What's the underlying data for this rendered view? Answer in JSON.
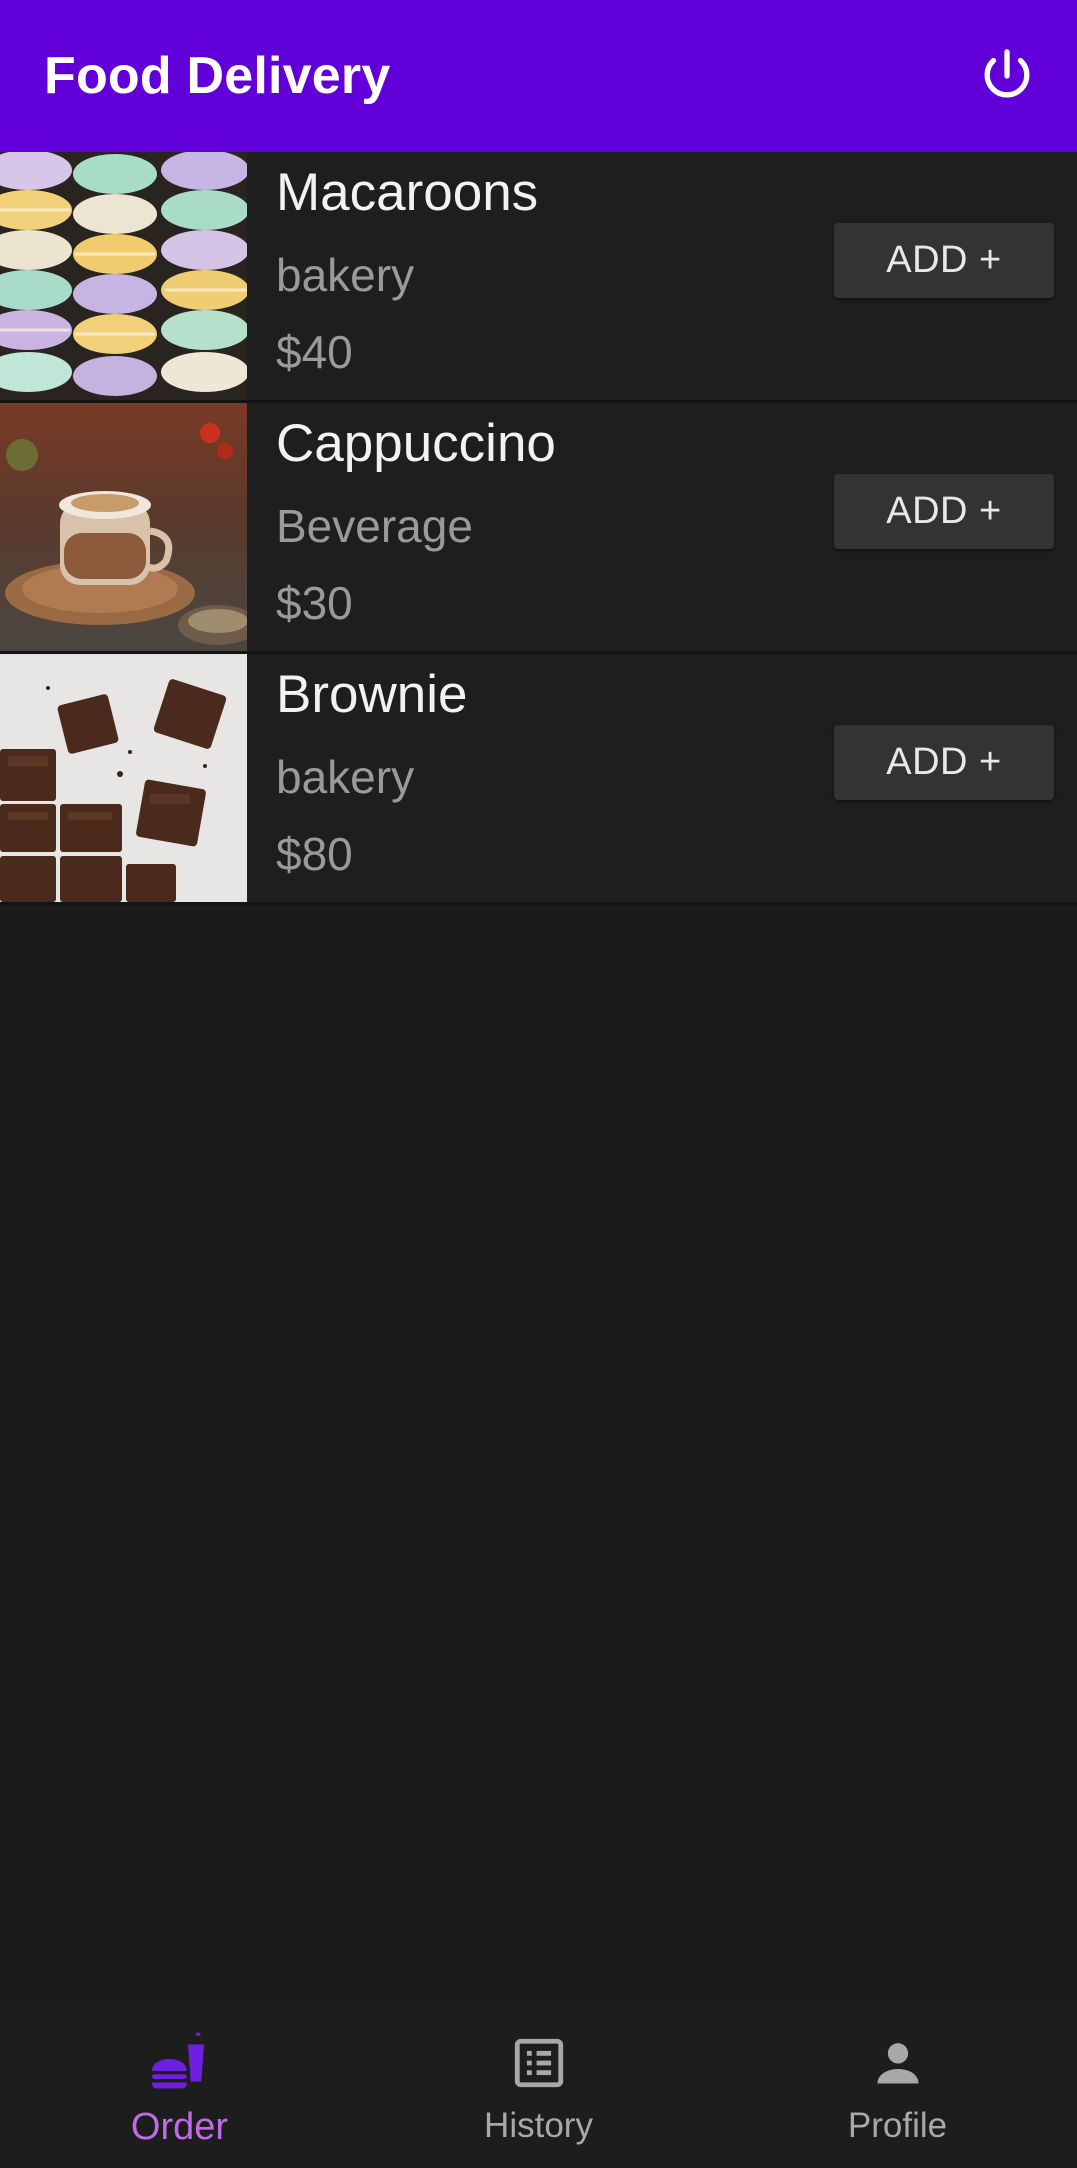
{
  "app_bar": {
    "title": "Food Delivery",
    "power_icon": "power-icon",
    "background": "#6200d9"
  },
  "items": [
    {
      "name": "Macaroons",
      "category": "bakery",
      "price": "$40",
      "add_label": "ADD +",
      "image": "macaroons-photo"
    },
    {
      "name": "Cappuccino",
      "category": "Beverage",
      "price": "$30",
      "add_label": "ADD +",
      "image": "cappuccino-photo"
    },
    {
      "name": "Brownie",
      "category": "bakery",
      "price": "$80",
      "add_label": "ADD +",
      "image": "brownie-photo"
    }
  ],
  "bottom_nav": {
    "items": [
      {
        "label": "Order",
        "icon": "fastfood-icon",
        "active": true
      },
      {
        "label": "History",
        "icon": "list-icon",
        "active": false
      },
      {
        "label": "Profile",
        "icon": "person-icon",
        "active": false
      }
    ],
    "active_color": "#c06ae8",
    "inactive_color": "#a8a8a8"
  }
}
